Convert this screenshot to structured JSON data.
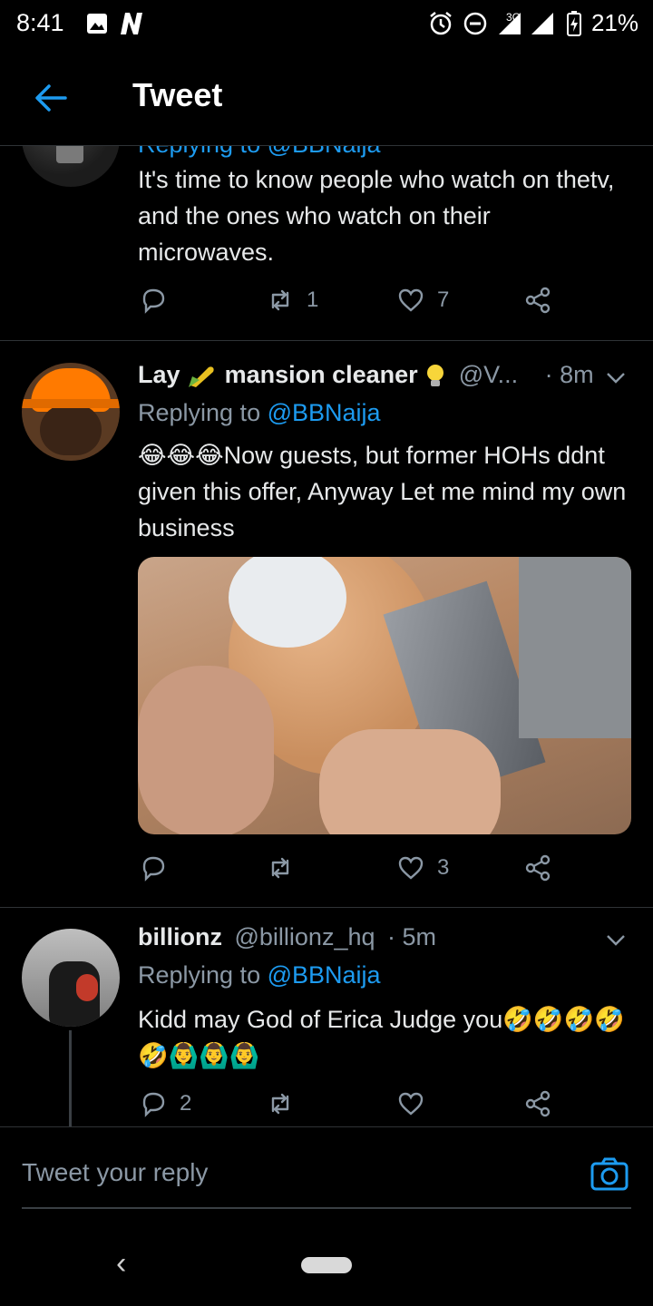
{
  "status_bar": {
    "time": "8:41",
    "network": "3G",
    "battery": "21%"
  },
  "header": {
    "title": "Tweet"
  },
  "tweets": [
    {
      "replying_partial": "Replying to @BBNaija",
      "text": "It's time to know people who watch on thetv, and the ones who watch on their microwaves.",
      "reply_count": "",
      "retweet_count": "1",
      "like_count": "7"
    },
    {
      "name_part1": "Lay",
      "name_part2": "mansion cleaner",
      "handle": "@V...",
      "time": "· 8m",
      "replying_prefix": "Replying to",
      "replying_handle": "@BBNaija",
      "text_emoji": "😂😂😂",
      "text": "Now guests, but former HOHs ddnt given this offer, Anyway Let me mind my own business",
      "reply_count": "",
      "retweet_count": "",
      "like_count": "3"
    },
    {
      "name": "billionz",
      "handle": "@billionz_hq",
      "time": "· 5m",
      "replying_prefix": "Replying to",
      "replying_handle": "@BBNaija",
      "text": "Kidd may God of Erica Judge you🤣🤣🤣🤣🤣🙆‍♂️🙆‍♂️🙆‍♂️",
      "reply_count": "2",
      "retweet_count": "",
      "like_count": ""
    }
  ],
  "reply_bar": {
    "placeholder": "Tweet your reply"
  },
  "nav": {
    "back_glyph": "‹"
  },
  "colors": {
    "accent": "#1d9bf0",
    "background": "#000000",
    "muted": "#8b98a5"
  }
}
